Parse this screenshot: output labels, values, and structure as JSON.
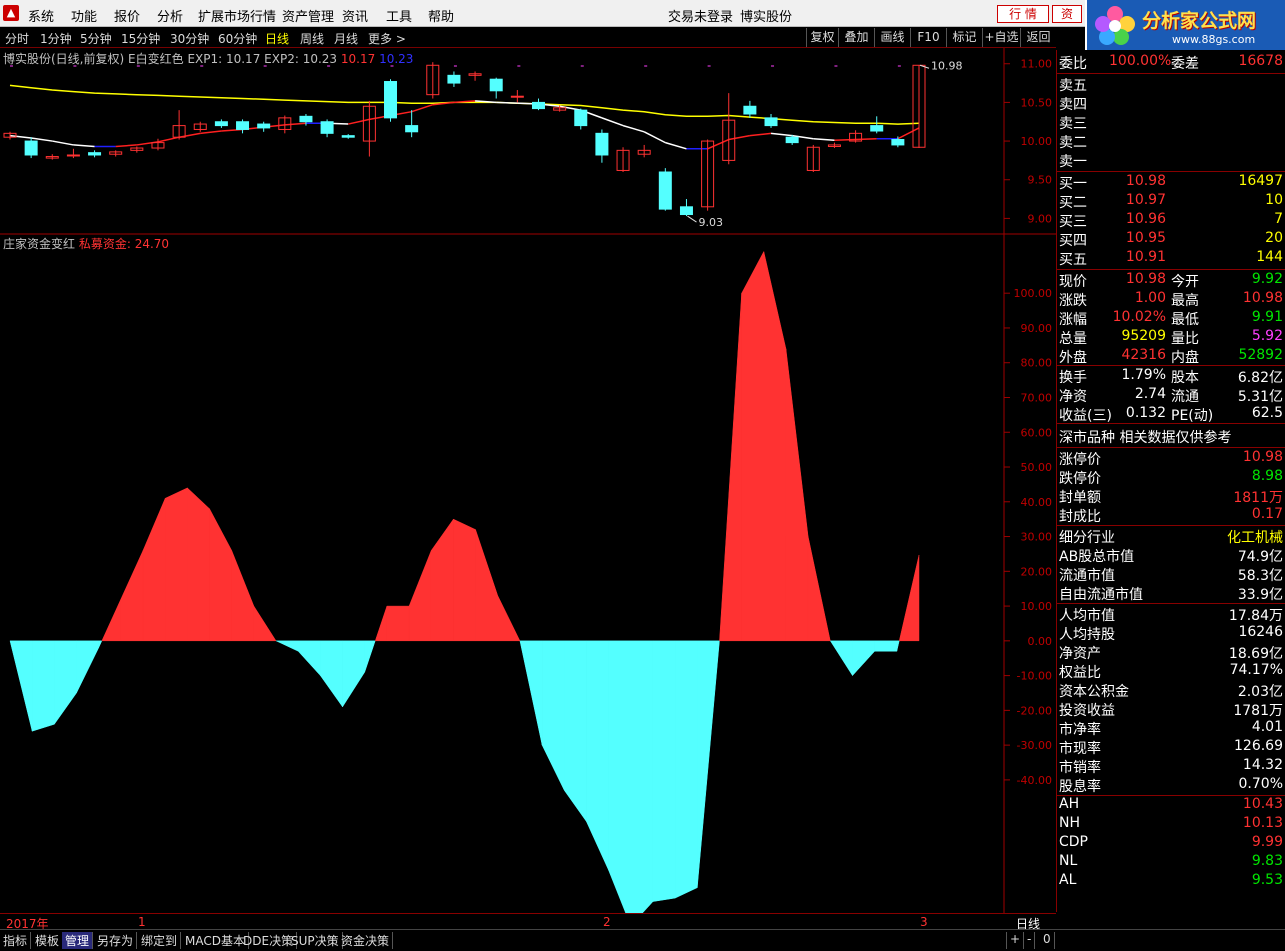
{
  "menubar": {
    "items": [
      "系统",
      "功能",
      "报价",
      "分析",
      "扩展市场行情",
      "资产管理",
      "资讯",
      "工具",
      "帮助"
    ],
    "status": "交易未登录",
    "stock": "博实股份",
    "btn_quote": "行 情",
    "btn_asset": "资"
  },
  "brand": {
    "title": "分析家公式网",
    "url": "www.88gs.com"
  },
  "periodbar": {
    "items": [
      "分时",
      "1分钟",
      "5分钟",
      "15分钟",
      "30分钟",
      "60分钟",
      "日线",
      "周线",
      "月线",
      "更多 >"
    ],
    "active": "日线",
    "right_buttons": [
      "复权",
      "叠加",
      "画线",
      "F10",
      "标记",
      "+自选",
      "返回"
    ]
  },
  "main_chart": {
    "title": "博实股份(日线,前复权)",
    "indicator": "E白变红色",
    "exp1_label": "EXP1: 10.17",
    "exp2_label": "EXP2: 10.23",
    "val_red": "10.17",
    "val_blue": "10.23",
    "y_ticks": [
      "11.00",
      "10.50",
      "10.00",
      "9.50",
      "9.00"
    ],
    "high_label": "10.98",
    "low_label": "9.03"
  },
  "sub_chart": {
    "title": "庄家资金变红",
    "series_label": "私募资金: 24.70",
    "y_ticks": [
      "100.00",
      "90.00",
      "80.00",
      "70.00",
      "60.00",
      "50.00",
      "40.00",
      "30.00",
      "20.00",
      "10.00",
      "0.00",
      "-10.00",
      "-20.00",
      "-30.00",
      "-40.00"
    ]
  },
  "chart_data": [
    {
      "type": "line",
      "title": "博实股份(日线,前复权)",
      "ylim": [
        8.85,
        11.1
      ],
      "candles": [
        {
          "o": 10.05,
          "c": 10.1,
          "h": 10.12,
          "l": 10.02
        },
        {
          "o": 10.0,
          "c": 9.82,
          "h": 10.05,
          "l": 9.78
        },
        {
          "o": 9.78,
          "c": 9.8,
          "h": 9.83,
          "l": 9.76
        },
        {
          "o": 9.82,
          "c": 9.82,
          "h": 9.9,
          "l": 9.78
        },
        {
          "o": 9.85,
          "c": 9.82,
          "h": 9.88,
          "l": 9.79
        },
        {
          "o": 9.83,
          "c": 9.86,
          "h": 9.88,
          "l": 9.8
        },
        {
          "o": 9.88,
          "c": 9.91,
          "h": 9.93,
          "l": 9.85
        },
        {
          "o": 9.91,
          "c": 9.98,
          "h": 10.03,
          "l": 9.88
        },
        {
          "o": 10.05,
          "c": 10.2,
          "h": 10.4,
          "l": 10.02
        },
        {
          "o": 10.15,
          "c": 10.22,
          "h": 10.25,
          "l": 10.12
        },
        {
          "o": 10.25,
          "c": 10.2,
          "h": 10.28,
          "l": 10.17
        },
        {
          "o": 10.25,
          "c": 10.15,
          "h": 10.28,
          "l": 10.1
        },
        {
          "o": 10.22,
          "c": 10.17,
          "h": 10.25,
          "l": 10.12
        },
        {
          "o": 10.15,
          "c": 10.3,
          "h": 10.33,
          "l": 10.1
        },
        {
          "o": 10.32,
          "c": 10.25,
          "h": 10.35,
          "l": 10.2
        },
        {
          "o": 10.25,
          "c": 10.1,
          "h": 10.28,
          "l": 10.05
        },
        {
          "o": 10.07,
          "c": 10.05,
          "h": 10.09,
          "l": 10.03
        },
        {
          "o": 10.0,
          "c": 10.45,
          "h": 10.52,
          "l": 9.8
        },
        {
          "o": 10.77,
          "c": 10.3,
          "h": 10.8,
          "l": 10.25
        },
        {
          "o": 10.2,
          "c": 10.12,
          "h": 10.4,
          "l": 10.05
        },
        {
          "o": 10.6,
          "c": 10.98,
          "h": 11.02,
          "l": 10.55
        },
        {
          "o": 10.85,
          "c": 10.75,
          "h": 10.9,
          "l": 10.7
        },
        {
          "o": 10.85,
          "c": 10.87,
          "h": 10.9,
          "l": 10.78
        },
        {
          "o": 10.8,
          "c": 10.65,
          "h": 10.82,
          "l": 10.55
        },
        {
          "o": 10.58,
          "c": 10.58,
          "h": 10.66,
          "l": 10.5
        },
        {
          "o": 10.5,
          "c": 10.42,
          "h": 10.55,
          "l": 10.4
        },
        {
          "o": 10.4,
          "c": 10.43,
          "h": 10.46,
          "l": 10.38
        },
        {
          "o": 10.4,
          "c": 10.2,
          "h": 10.42,
          "l": 10.15
        },
        {
          "o": 10.1,
          "c": 9.82,
          "h": 10.15,
          "l": 9.72
        },
        {
          "o": 9.62,
          "c": 9.88,
          "h": 9.92,
          "l": 9.6
        },
        {
          "o": 9.83,
          "c": 9.88,
          "h": 9.95,
          "l": 9.79
        },
        {
          "o": 9.6,
          "c": 9.12,
          "h": 9.65,
          "l": 9.1
        },
        {
          "o": 9.15,
          "c": 9.05,
          "h": 9.25,
          "l": 9.03
        },
        {
          "o": 9.15,
          "c": 10.0,
          "h": 10.02,
          "l": 9.1
        },
        {
          "o": 9.75,
          "c": 10.27,
          "h": 10.62,
          "l": 9.7
        },
        {
          "o": 10.45,
          "c": 10.35,
          "h": 10.52,
          "l": 10.3
        },
        {
          "o": 10.3,
          "c": 10.2,
          "h": 10.35,
          "l": 10.17
        },
        {
          "o": 10.05,
          "c": 9.98,
          "h": 10.08,
          "l": 9.95
        },
        {
          "o": 9.62,
          "c": 9.92,
          "h": 9.95,
          "l": 9.6
        },
        {
          "o": 9.93,
          "c": 9.95,
          "h": 9.98,
          "l": 9.91
        },
        {
          "o": 10.0,
          "c": 10.1,
          "h": 10.14,
          "l": 9.98
        },
        {
          "o": 10.2,
          "c": 10.13,
          "h": 10.32,
          "l": 10.1
        },
        {
          "o": 10.02,
          "c": 9.95,
          "h": 10.06,
          "l": 9.92
        },
        {
          "o": 9.92,
          "c": 10.98,
          "h": 10.98,
          "l": 9.91
        }
      ],
      "exp1_white": [
        10.07,
        10.04,
        10.0,
        9.95,
        9.93,
        9.93,
        9.95,
        9.99,
        10.05,
        10.1,
        10.13,
        10.15,
        10.18,
        10.21,
        10.23,
        10.23,
        10.22,
        10.28,
        10.33,
        10.38,
        10.47,
        10.5,
        10.52,
        10.5,
        10.49,
        10.48,
        10.45,
        10.4,
        10.3,
        10.2,
        10.12,
        9.98,
        9.9,
        9.9,
        10.02,
        10.07,
        10.1,
        10.07,
        10.03,
        10.01,
        10.02,
        10.03,
        10.03,
        10.17
      ],
      "exp2_yellow": [
        10.72,
        10.69,
        10.66,
        10.64,
        10.62,
        10.61,
        10.6,
        10.59,
        10.58,
        10.57,
        10.56,
        10.55,
        10.54,
        10.53,
        10.52,
        10.51,
        10.5,
        10.5,
        10.5,
        10.49,
        10.49,
        10.5,
        10.5,
        10.5,
        10.49,
        10.48,
        10.47,
        10.46,
        10.43,
        10.4,
        10.38,
        10.34,
        10.32,
        10.32,
        10.33,
        10.31,
        10.29,
        10.27,
        10.25,
        10.24,
        10.23,
        10.23,
        10.22,
        10.23
      ]
    },
    {
      "type": "area",
      "title": "庄家资金变红",
      "ylim": [
        -78,
        113
      ],
      "series": [
        {
          "name": "私募资金",
          "values": [
            0,
            -26,
            -24,
            -15,
            -2,
            12,
            26,
            41,
            44,
            38,
            26,
            10,
            0,
            -3,
            -10,
            -19,
            -9,
            10,
            10,
            26,
            35,
            32,
            13,
            0,
            -30,
            -43,
            -52,
            -66,
            -82,
            -75,
            -74,
            -71,
            0,
            100,
            112,
            84,
            30,
            0,
            -10,
            -3,
            -3,
            24.7
          ]
        }
      ]
    }
  ],
  "quote": {
    "wei_bi_label": "委比",
    "wei_bi": "100.00%",
    "wei_cha_label": "委差",
    "wei_cha": "16678",
    "sells": [
      {
        "label": "卖五"
      },
      {
        "label": "卖四"
      },
      {
        "label": "卖三"
      },
      {
        "label": "卖二"
      },
      {
        "label": "卖一"
      }
    ],
    "buys": [
      {
        "label": "买一",
        "price": "10.98",
        "vol": "16497"
      },
      {
        "label": "买二",
        "price": "10.97",
        "vol": "10"
      },
      {
        "label": "买三",
        "price": "10.96",
        "vol": "7"
      },
      {
        "label": "买四",
        "price": "10.95",
        "vol": "20"
      },
      {
        "label": "买五",
        "price": "10.91",
        "vol": "144"
      }
    ],
    "stats1": [
      {
        "l1": "现价",
        "v1": "10.98",
        "c1": "red",
        "l2": "今开",
        "v2": "9.92",
        "c2": "green"
      },
      {
        "l1": "涨跌",
        "v1": "1.00",
        "c1": "red",
        "l2": "最高",
        "v2": "10.98",
        "c2": "red"
      },
      {
        "l1": "涨幅",
        "v1": "10.02%",
        "c1": "red",
        "l2": "最低",
        "v2": "9.91",
        "c2": "green"
      },
      {
        "l1": "总量",
        "v1": "95209",
        "c1": "yellow",
        "l2": "量比",
        "v2": "5.92",
        "c2": "magenta"
      },
      {
        "l1": "外盘",
        "v1": "42316",
        "c1": "red",
        "l2": "内盘",
        "v2": "52892",
        "c2": "green"
      }
    ],
    "stats2": [
      {
        "l1": "换手",
        "v1": "1.79%",
        "l2": "股本",
        "v2": "6.82亿"
      },
      {
        "l1": "净资",
        "v1": "2.74",
        "l2": "流通",
        "v2": "5.31亿"
      },
      {
        "l1": "收益(三)",
        "v1": "0.132",
        "l2": "PE(动)",
        "v2": "62.5"
      }
    ],
    "note": "深市品种  相关数据仅供参考",
    "limits": [
      {
        "label": "涨停价",
        "value": "10.98",
        "color": "red"
      },
      {
        "label": "跌停价",
        "value": "8.98",
        "color": "green"
      },
      {
        "label": "封单额",
        "value": "1811万",
        "color": "red"
      },
      {
        "label": "封成比",
        "value": "0.17",
        "color": "red"
      }
    ],
    "industry_label": "细分行业",
    "industry": "化工机械",
    "fund": [
      {
        "label": "AB股总市值",
        "value": "74.9亿"
      },
      {
        "label": "流通市值",
        "value": "58.3亿"
      },
      {
        "label": "自由流通市值",
        "value": "33.9亿"
      }
    ],
    "fund2": [
      {
        "label": "人均市值",
        "value": "17.84万"
      },
      {
        "label": "人均持股",
        "value": "16246"
      },
      {
        "label": "净资产",
        "value": "18.69亿"
      },
      {
        "label": "权益比",
        "value": "74.17%"
      },
      {
        "label": "资本公积金",
        "value": "2.03亿"
      },
      {
        "label": "投资收益",
        "value": "1781万"
      },
      {
        "label": "市净率",
        "value": "4.01"
      },
      {
        "label": "市现率",
        "value": "126.69"
      },
      {
        "label": "市销率",
        "value": "14.32"
      },
      {
        "label": "股息率",
        "value": "0.70%"
      }
    ],
    "tech": [
      {
        "label": "AH",
        "value": "10.43",
        "color": "red"
      },
      {
        "label": "NH",
        "value": "10.13",
        "color": "red"
      },
      {
        "label": "CDP",
        "value": "9.99",
        "color": "red"
      },
      {
        "label": "NL",
        "value": "9.83",
        "color": "green"
      },
      {
        "label": "AL",
        "value": "9.53",
        "color": "green"
      }
    ]
  },
  "datebar": {
    "year": "2017年",
    "m1": "1",
    "m2": "2",
    "m3": "3",
    "period": "日线"
  },
  "bottom_tabs": [
    "指标",
    "模板",
    "管理",
    "另存为",
    "绑定到",
    "MACD基本",
    "DDE决策",
    "SUP决策",
    "资金决策"
  ],
  "bottom_active": "管理",
  "bottom_right": [
    "+",
    "-",
    "0"
  ],
  "colors": {
    "up": "#ff3232",
    "down": "#54ffff",
    "white_line": "#ffffff",
    "yellow_line": "#ffff00",
    "grid": "#800000"
  }
}
